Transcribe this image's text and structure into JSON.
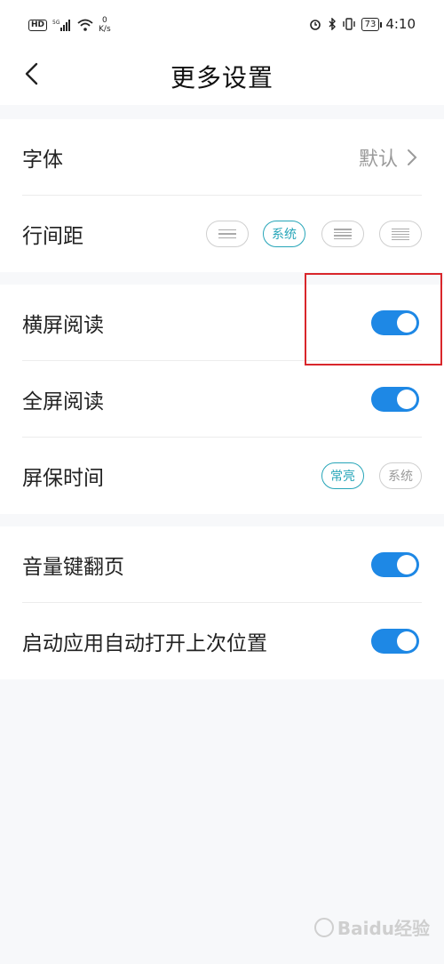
{
  "status_bar": {
    "hd": "HD",
    "net": "5G",
    "speed_value": "0",
    "speed_unit": "K/s",
    "battery": "73",
    "time": "4:10"
  },
  "header": {
    "title": "更多设置"
  },
  "group1": {
    "font": {
      "label": "字体",
      "value": "默认"
    },
    "line_spacing": {
      "label": "行间距",
      "selected": "系统"
    }
  },
  "group2": {
    "landscape": {
      "label": "横屏阅读",
      "on": true
    },
    "fullscreen": {
      "label": "全屏阅读",
      "on": true
    },
    "screensaver": {
      "label": "屏保时间",
      "options": [
        "常亮",
        "系统"
      ],
      "selected": "常亮"
    }
  },
  "group3": {
    "volume_key": {
      "label": "音量键翻页",
      "on": true
    },
    "resume": {
      "label": "启动应用自动打开上次位置",
      "on": true
    }
  },
  "watermark": "Baidu经验",
  "colors": {
    "accent": "#1e88e5",
    "teal": "#26a5b8",
    "highlight": "#d9262b"
  }
}
